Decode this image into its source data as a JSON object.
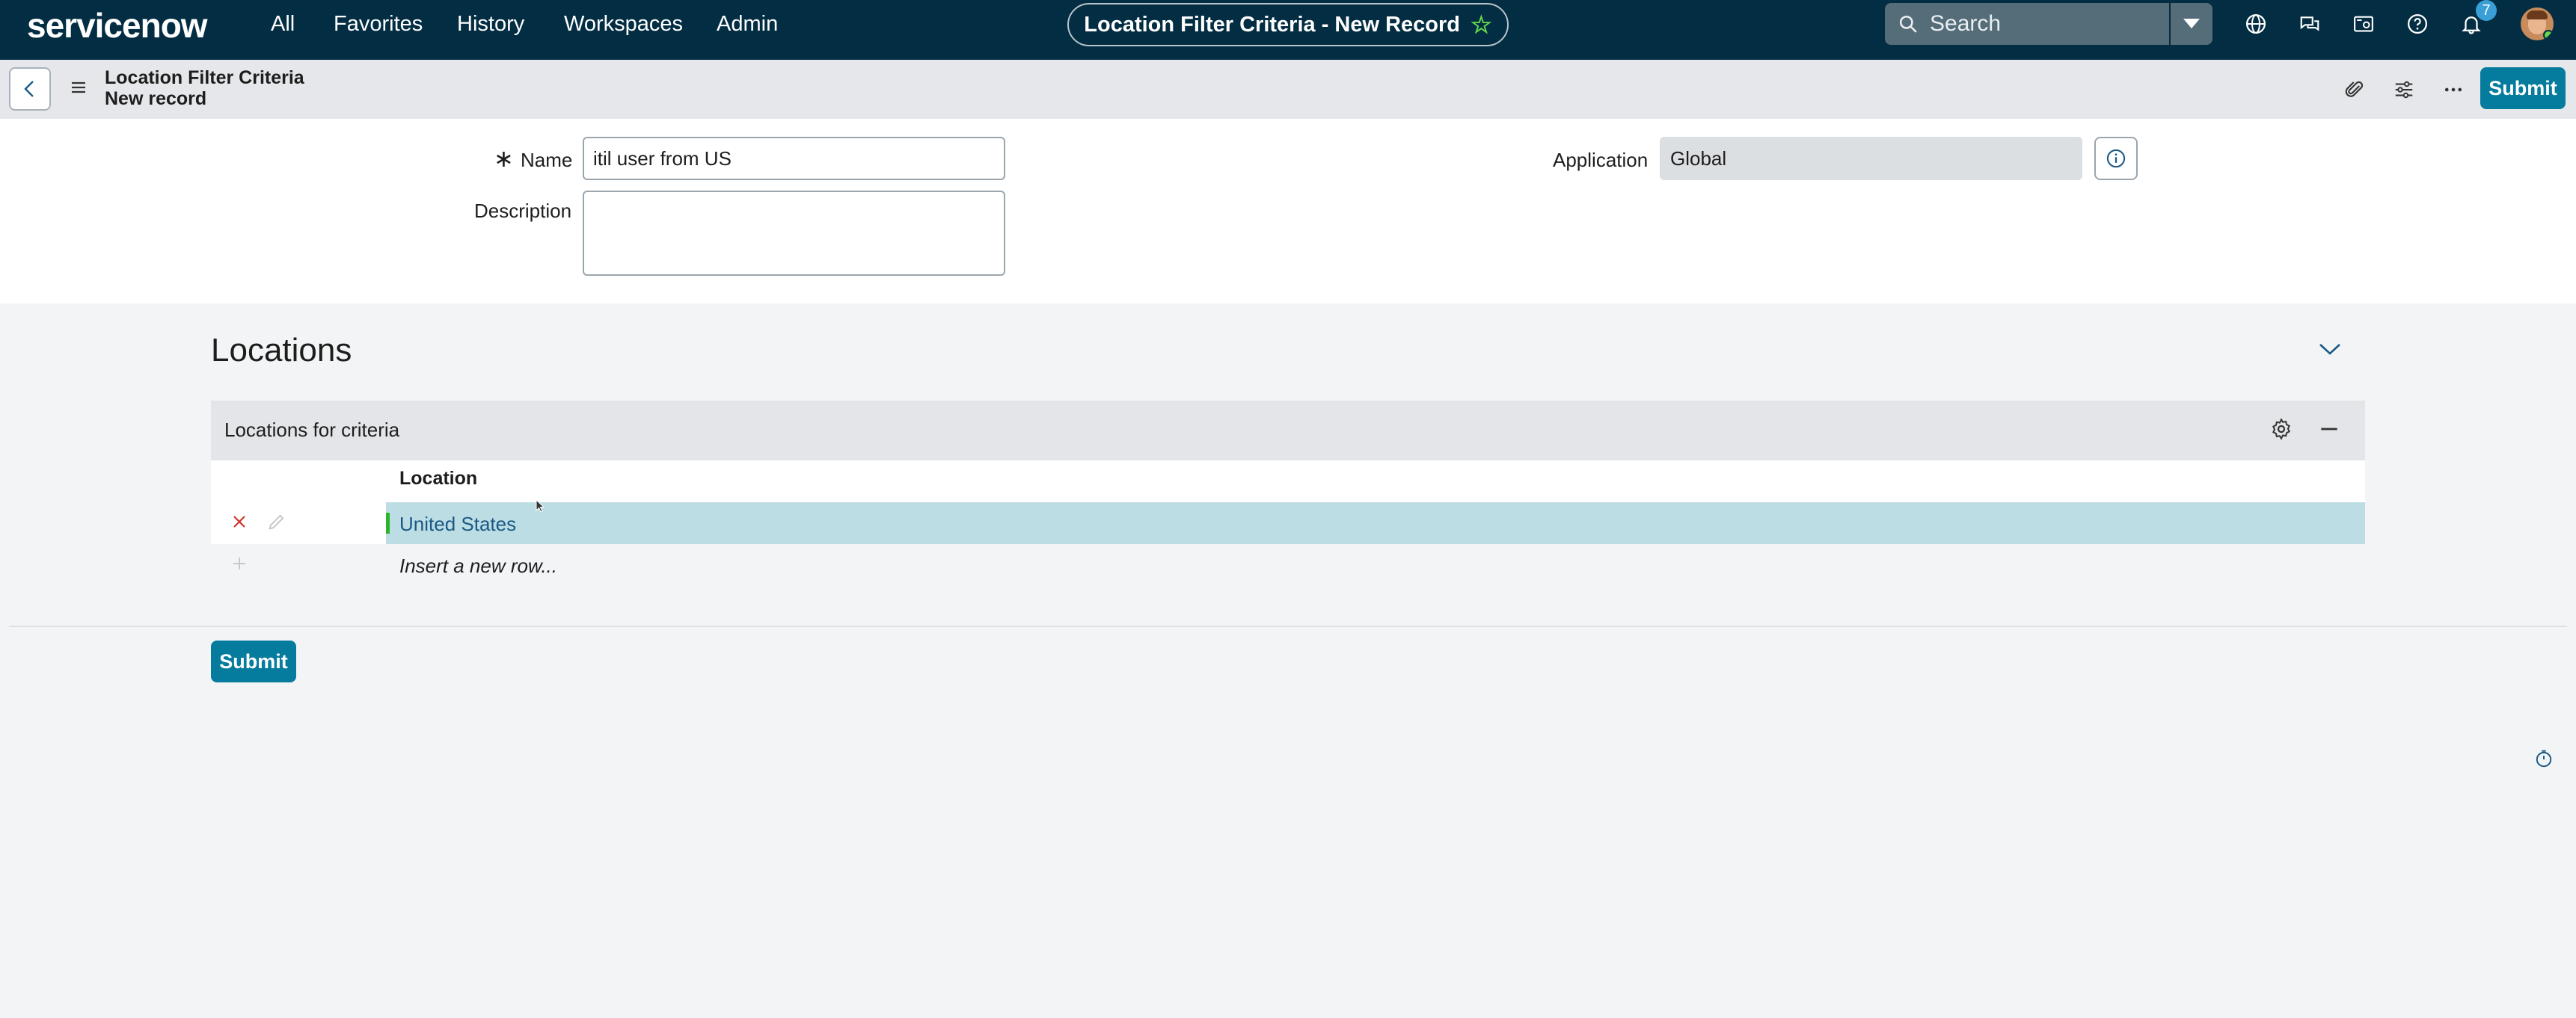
{
  "nav": {
    "logo": "servicenow",
    "items": [
      "All",
      "Favorites",
      "History",
      "Workspaces",
      "Admin"
    ],
    "context_title": "Location Filter Criteria - New Record",
    "search_placeholder": "Search",
    "notification_count": "7"
  },
  "record": {
    "title_line1": "Location Filter Criteria",
    "title_line2": "New record",
    "submit_label": "Submit"
  },
  "form": {
    "name_label": "Name",
    "name_value": "itil user from US",
    "description_label": "Description",
    "description_value": "",
    "application_label": "Application",
    "application_value": "Global"
  },
  "locations": {
    "section_title": "Locations",
    "list_title": "Locations for criteria",
    "column_header": "Location",
    "rows": [
      "United States"
    ],
    "insert_row_label": "Insert a new row..."
  },
  "footer": {
    "submit_label": "Submit"
  },
  "colors": {
    "nav_bg": "#032d42",
    "accent": "#057c9e",
    "selected_row": "#bcdde4"
  },
  "icons": [
    "search-icon",
    "chevron-down-icon",
    "globe-icon",
    "chat-icon",
    "screenshot-icon",
    "help-icon",
    "bell-icon",
    "back-arrow-icon",
    "hamburger-icon",
    "paperclip-icon",
    "sliders-icon",
    "more-icon",
    "info-icon",
    "gear-icon",
    "minimize-icon",
    "delete-icon",
    "edit-icon",
    "add-icon",
    "timer-icon",
    "star-icon"
  ]
}
